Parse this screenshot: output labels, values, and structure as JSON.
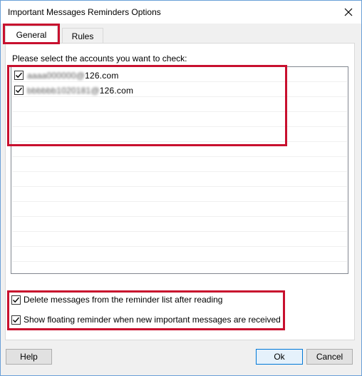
{
  "window": {
    "title": "Important Messages Reminders Options"
  },
  "tabs": [
    {
      "label": "General",
      "active": true
    },
    {
      "label": "Rules",
      "active": false
    }
  ],
  "general": {
    "prompt": "Please select the accounts you want to check:",
    "accounts": [
      {
        "prefix": "aaaa000000@",
        "domain": "126.com",
        "checked": true
      },
      {
        "prefix": "bbbbbb1020181@",
        "domain": "126.com",
        "checked": true
      }
    ],
    "options": [
      {
        "label": "Delete messages from the reminder list after reading",
        "checked": true
      },
      {
        "label": "Show floating reminder when new important messages are received",
        "checked": true
      }
    ]
  },
  "buttons": {
    "help": "Help",
    "ok": "Ok",
    "cancel": "Cancel"
  },
  "colors": {
    "highlight": "#c8102e",
    "window_border": "#6aa0d8"
  },
  "icons": {
    "close": "close-icon",
    "check": "checkmark-icon"
  }
}
